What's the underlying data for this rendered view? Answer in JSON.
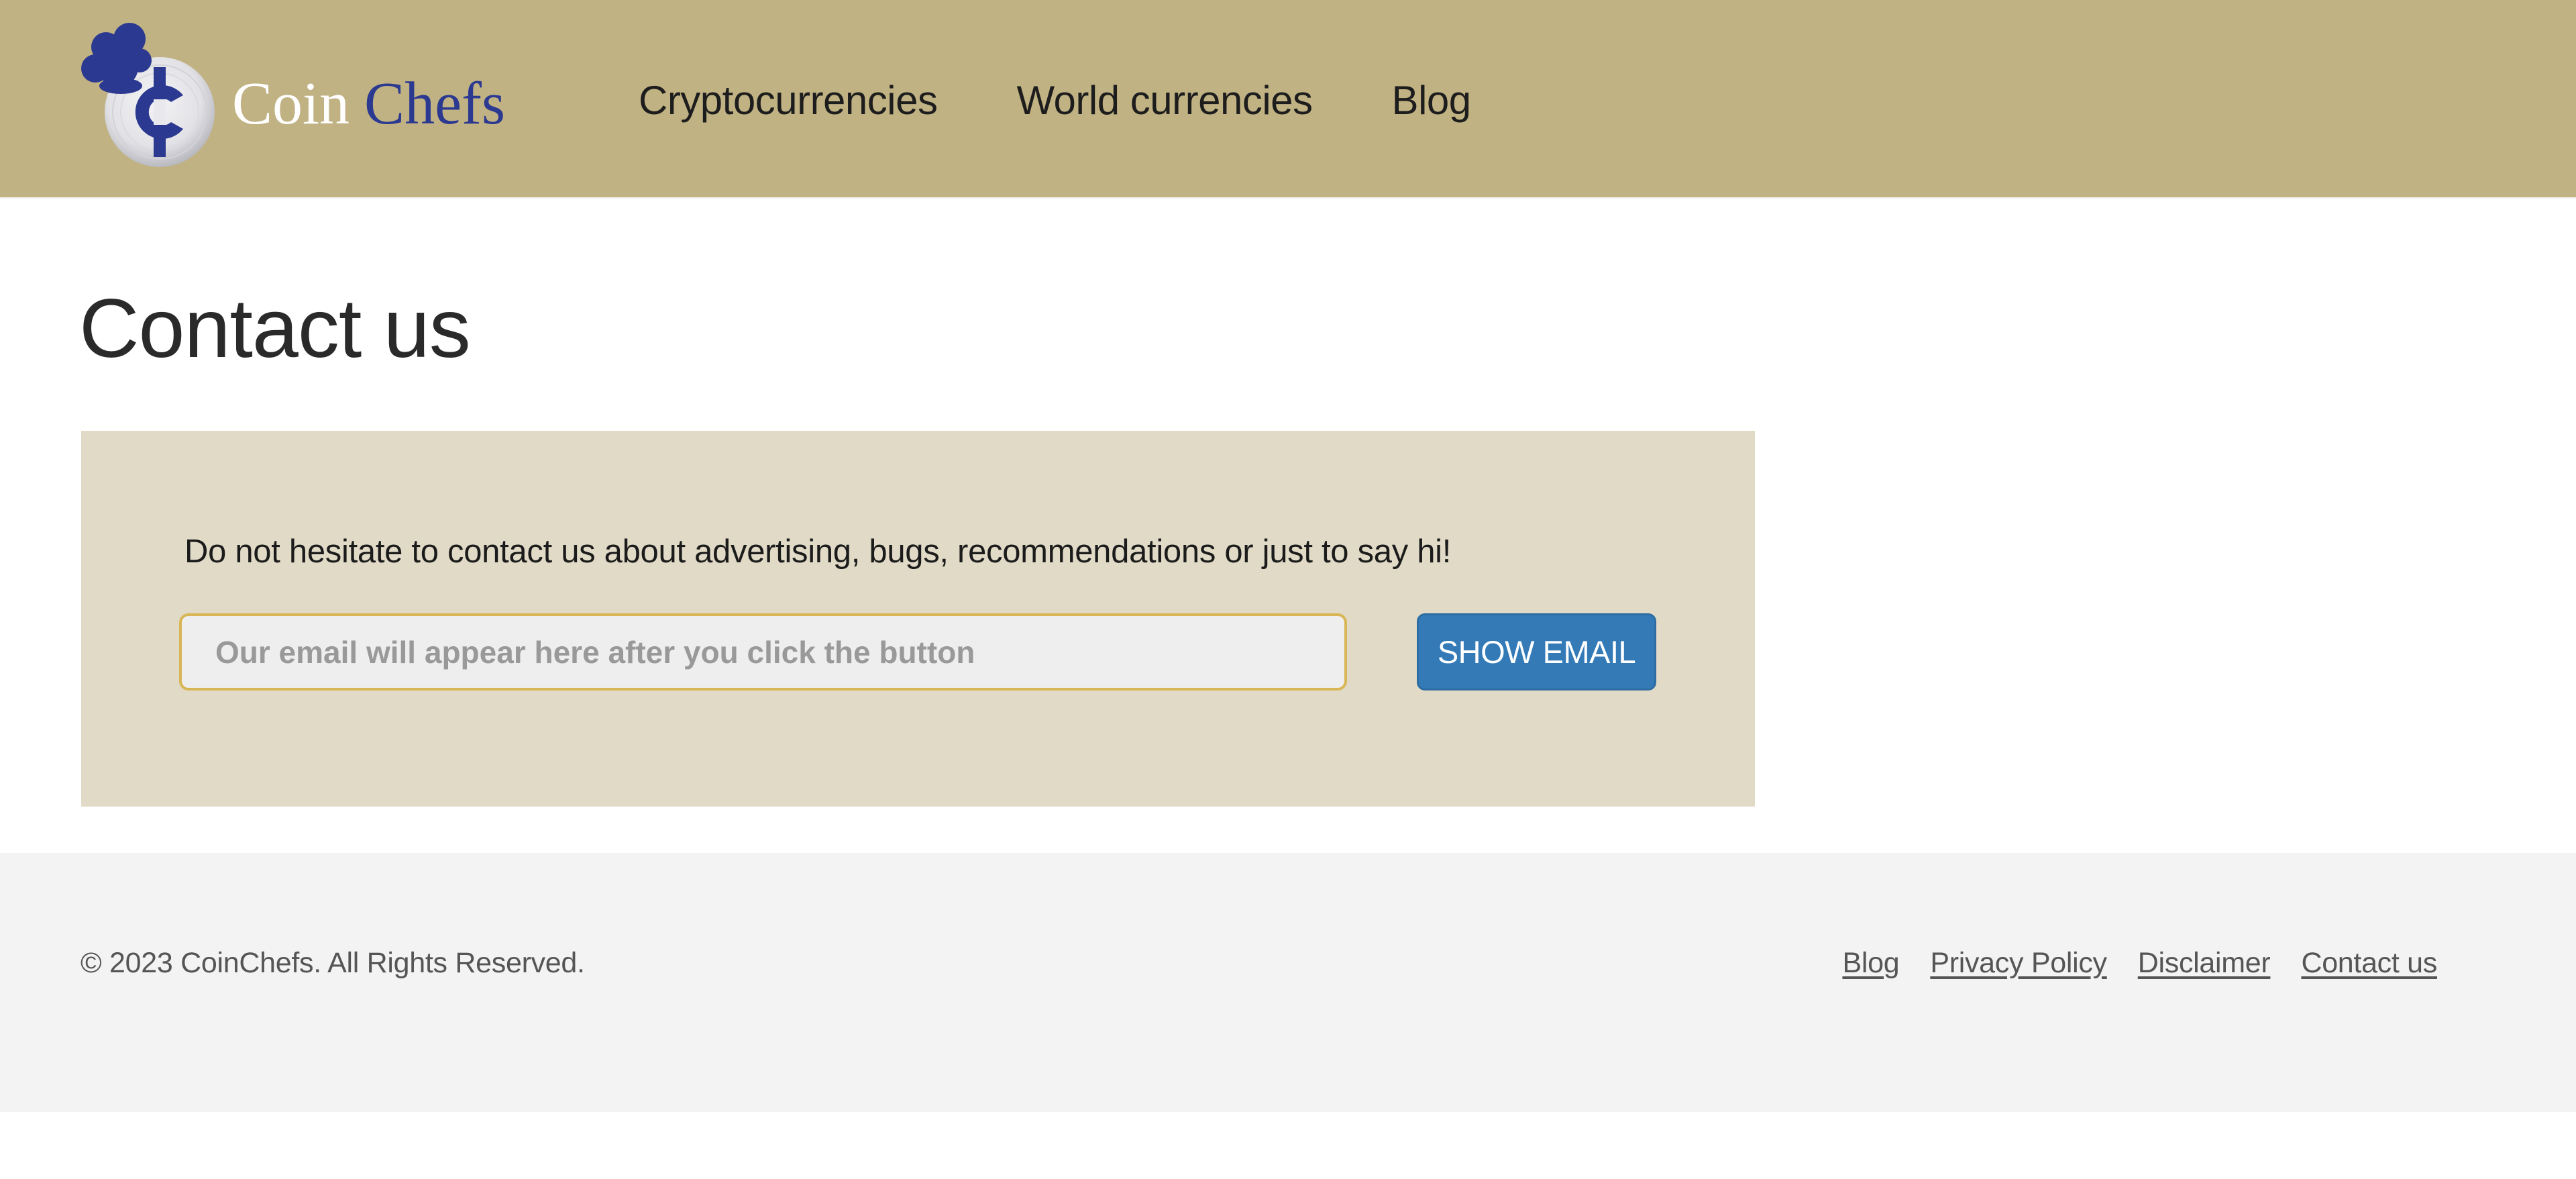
{
  "header": {
    "logo": {
      "word1": "Coin",
      "word2": "Chefs",
      "icon": "chef-hat-coin-icon"
    },
    "nav": [
      {
        "label": "Cryptocurrencies"
      },
      {
        "label": "World currencies"
      },
      {
        "label": "Blog"
      }
    ]
  },
  "main": {
    "title": "Contact us",
    "intro": "Do not hesitate to contact us about advertising, bugs, recommendations or just to say hi!",
    "email_input": {
      "value": "",
      "placeholder": "Our email will appear here after you click the button"
    },
    "show_email_label": "SHOW EMAIL"
  },
  "footer": {
    "copyright": "© 2023 CoinChefs. All Rights Reserved.",
    "links": [
      {
        "label": "Blog"
      },
      {
        "label": "Privacy Policy"
      },
      {
        "label": "Disclaimer"
      },
      {
        "label": "Contact us"
      }
    ]
  },
  "colors": {
    "header_bg": "#c0b283",
    "brand_blue": "#2b3990",
    "box_bg": "#e0dac6",
    "input_border": "#d9b655",
    "button_bg": "#337ab7",
    "footer_bg": "#f3f3f3"
  }
}
